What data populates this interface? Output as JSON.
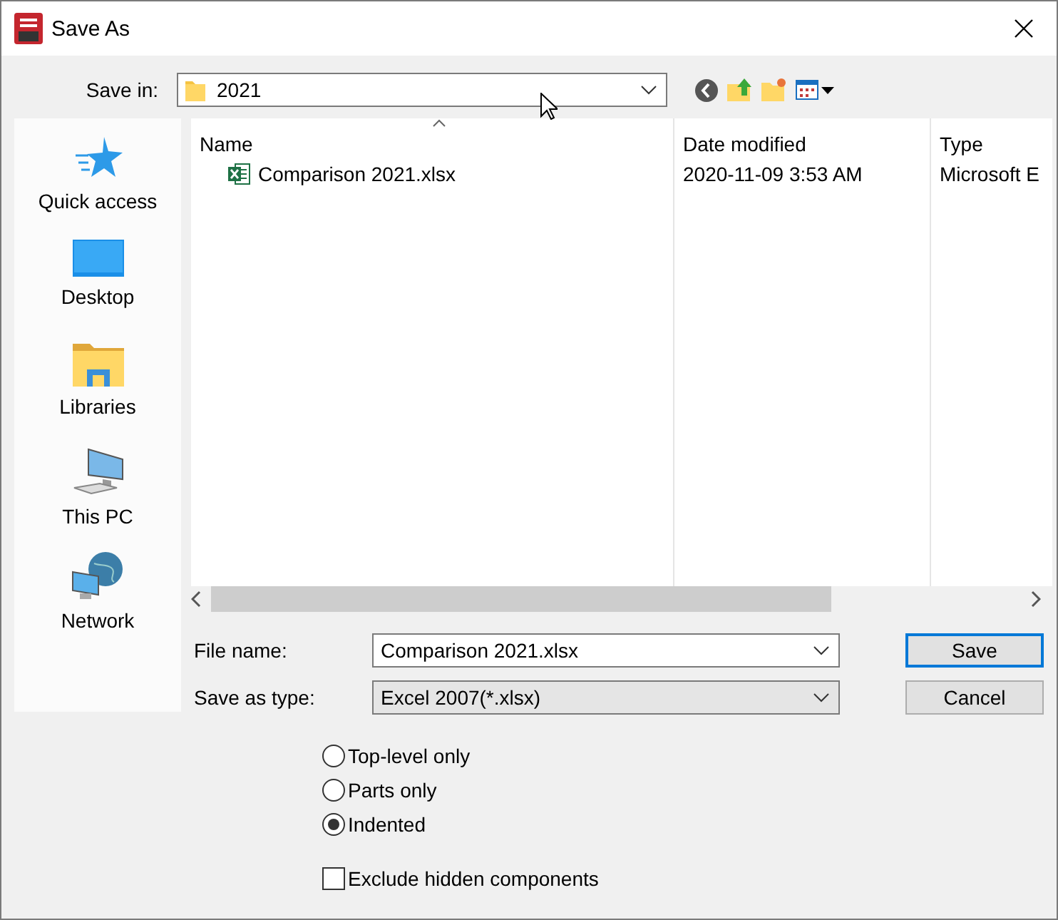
{
  "window": {
    "title": "Save As"
  },
  "save_in": {
    "label": "Save in:",
    "value": "2021"
  },
  "places": [
    {
      "label": "Quick access",
      "kind": "star"
    },
    {
      "label": "Desktop",
      "kind": "desktop"
    },
    {
      "label": "Libraries",
      "kind": "library"
    },
    {
      "label": "This PC",
      "kind": "pc"
    },
    {
      "label": "Network",
      "kind": "network"
    }
  ],
  "file_list": {
    "columns": [
      {
        "label": "Name",
        "sorted": true
      },
      {
        "label": "Date modified",
        "sorted": false
      },
      {
        "label": "Type",
        "sorted": false
      }
    ],
    "rows": [
      {
        "name": "Comparison 2021.xlsx",
        "date": "2020-11-09 3:53 AM",
        "type": "Microsoft E"
      }
    ]
  },
  "file_name": {
    "label": "File name:",
    "value": "Comparison 2021.xlsx"
  },
  "save_type": {
    "label": "Save as type:",
    "value": "Excel 2007(*.xlsx)"
  },
  "buttons": [
    {
      "label": "Save",
      "default": true
    },
    {
      "label": "Cancel",
      "default": false
    }
  ],
  "options": [
    {
      "label": "Top-level only",
      "selected": false
    },
    {
      "label": "Parts only",
      "selected": false
    },
    {
      "label": "Indented",
      "selected": true
    }
  ],
  "exclude": {
    "label": "Exclude hidden components",
    "checked": false
  }
}
